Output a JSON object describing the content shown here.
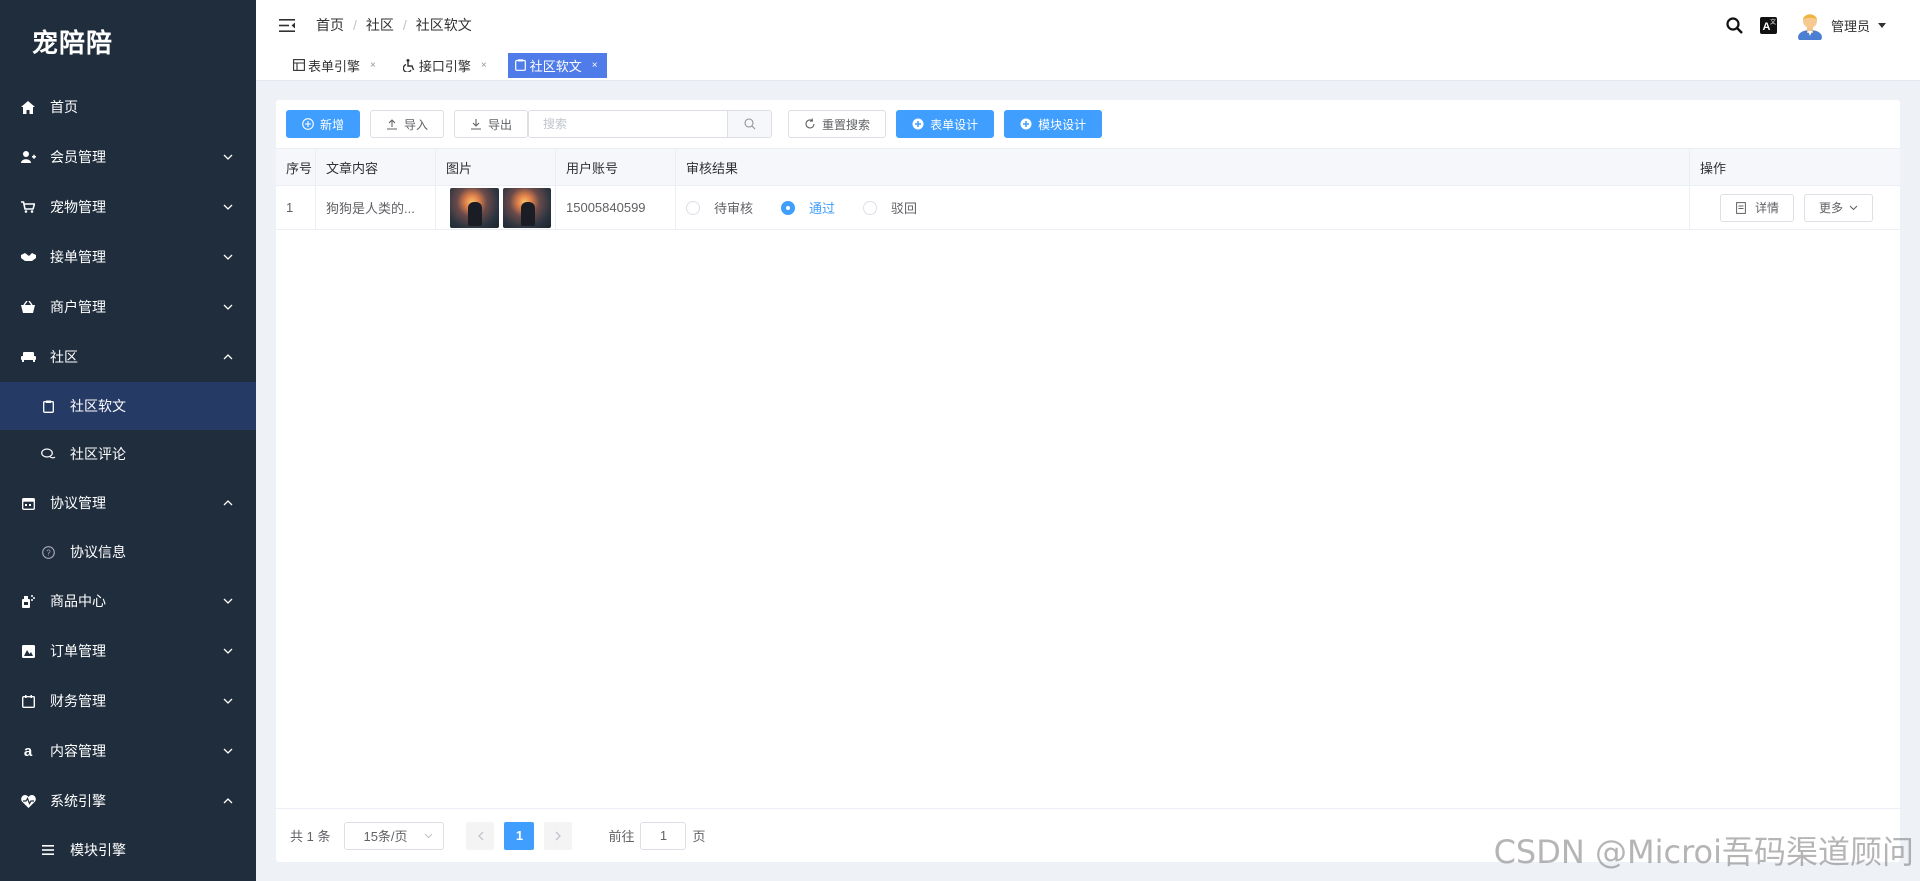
{
  "app": {
    "logo": "宠陪陪"
  },
  "sidebar": {
    "items": [
      {
        "label": "首页",
        "icon": "home-icon",
        "arrow": ""
      },
      {
        "label": "会员管理",
        "icon": "user-add-icon",
        "arrow": "down"
      },
      {
        "label": "宠物管理",
        "icon": "cart-icon",
        "arrow": "down"
      },
      {
        "label": "接单管理",
        "icon": "handshake-icon",
        "arrow": "down"
      },
      {
        "label": "商户管理",
        "icon": "basket-icon",
        "arrow": "down"
      },
      {
        "label": "社区",
        "icon": "sofa-icon",
        "arrow": "up"
      },
      {
        "label": "社区软文",
        "icon": "clipboard-icon",
        "sub": true,
        "active": true
      },
      {
        "label": "社区评论",
        "icon": "chat-icon",
        "sub": true
      },
      {
        "label": "协议管理",
        "icon": "calendar-icon",
        "arrow": "up"
      },
      {
        "label": "协议信息",
        "icon": "question-icon",
        "sub": true
      },
      {
        "label": "商品中心",
        "icon": "bottle-icon",
        "arrow": "down"
      },
      {
        "label": "订单管理",
        "icon": "image-icon",
        "arrow": "down"
      },
      {
        "label": "财务管理",
        "icon": "calendar-blank-icon",
        "arrow": "down"
      },
      {
        "label": "内容管理",
        "icon": "amazon-icon",
        "arrow": "down"
      },
      {
        "label": "系统引擎",
        "icon": "heartbeat-icon",
        "arrow": "up"
      },
      {
        "label": "模块引擎",
        "icon": "list-icon",
        "sub": true
      }
    ]
  },
  "header": {
    "breadcrumb": [
      "首页",
      "社区",
      "社区软文"
    ],
    "separator": "/",
    "user_name": "管理员"
  },
  "tags": [
    {
      "label": "表单引擎",
      "icon": "form-icon",
      "close": "×",
      "active": false
    },
    {
      "label": "接口引擎",
      "icon": "wheelchair-icon",
      "close": "×",
      "active": false
    },
    {
      "label": "社区软文",
      "icon": "clipboard-icon",
      "close": "×",
      "active": true
    }
  ],
  "toolbar": {
    "add_label": "新增",
    "import_label": "导入",
    "export_label": "导出",
    "search_placeholder": "搜索",
    "reset_label": "重置搜索",
    "form_design_label": "表单设计",
    "module_design_label": "模块设计"
  },
  "table": {
    "columns": [
      "序号",
      "文章内容",
      "图片",
      "用户账号",
      "审核结果",
      "操作"
    ],
    "rows": [
      {
        "index": "1",
        "content": "狗狗是人类的...",
        "account": "15005840599",
        "review_options": [
          "待审核",
          "通过",
          "驳回"
        ],
        "review_selected": "通过",
        "detail_label": "详情",
        "more_label": "更多"
      }
    ]
  },
  "pagination": {
    "total": "共 1 条",
    "page_size": "15条/页",
    "current_page": "1",
    "goto_label": "前往",
    "goto_value": "1",
    "page_unit": "页"
  },
  "watermark": "CSDN @Microi吾码渠道顾问",
  "colors": {
    "sidebar_bg": "#1f2d3d",
    "sidebar_active": "#263a66",
    "primary": "#409eff",
    "tag_active": "#4f7ce8"
  }
}
